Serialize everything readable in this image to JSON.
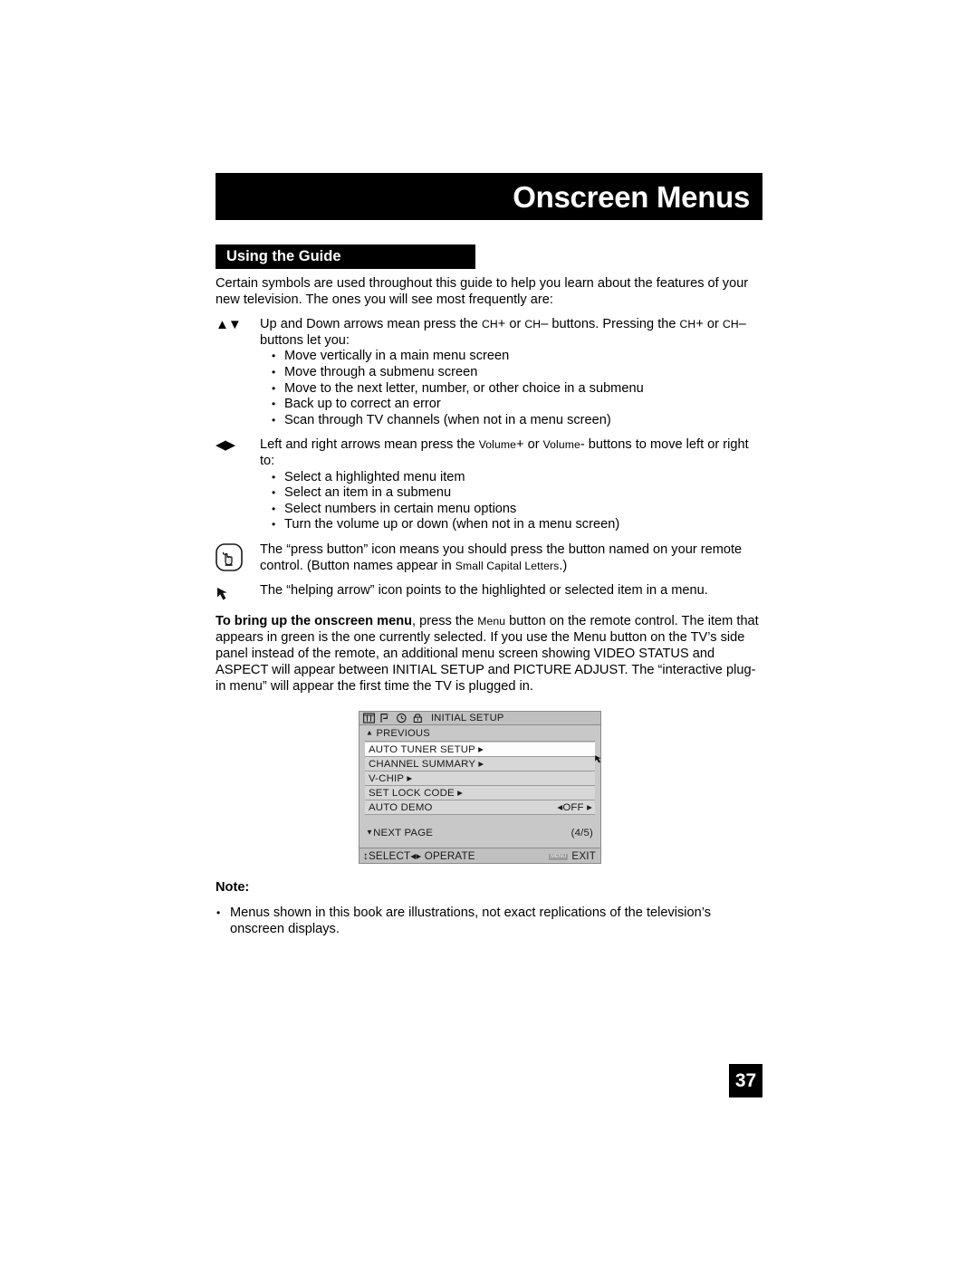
{
  "header": {
    "title": "Onscreen Menus",
    "section_title": "Using the Guide"
  },
  "intro": {
    "paragraph": "Certain symbols are used throughout this guide to help you learn about the features of your new television. The ones you will see most frequently are:"
  },
  "symbols": [
    {
      "icon": "up-down-arrows-icon",
      "glyph": "▲▼",
      "text_pre": "Up and Down arrows mean press the ",
      "sc1": "CH",
      "text_mid1": "+ or ",
      "sc2": "CH",
      "text_mid2": "– buttons. Pressing the ",
      "sc3": "CH",
      "text_mid3": "+ or ",
      "sc4": "CH",
      "text_post": "– buttons let you:",
      "bullets": [
        "Move vertically in a main menu screen",
        "Move through a submenu screen",
        "Move to the next letter, number, or other choice in a submenu",
        "Back up to correct an error",
        "Scan through TV channels (when not in a menu screen)"
      ]
    },
    {
      "icon": "left-right-arrows-icon",
      "glyph": "◀▶",
      "text_pre": "Left and right arrows mean press the ",
      "sc1": "Volume",
      "text_mid1": "+ or ",
      "sc2": "Volume",
      "text_post": "- buttons to move left or right to:",
      "bullets": [
        "Select a highlighted menu item",
        "Select an item in a submenu",
        "Select numbers in certain menu options",
        "Turn the volume up or down (when not in a menu screen)"
      ]
    },
    {
      "icon": "press-button-hand-icon",
      "text_pre": "The “press button” icon means you should press the button named on your remote control. (Button names appear in ",
      "sc1": "Small Capital Letters",
      "text_post": ".)"
    },
    {
      "icon": "helping-arrow-icon",
      "text_pre": "The “helping arrow” icon points to the highlighted or selected item in a menu."
    }
  ],
  "menu_intro": {
    "bold_lead": "To bring up the onscreen menu",
    "text_1": ", press the ",
    "sc_menu": "Menu",
    "text_2": " button on the remote control. The item that appears in green is the one currently selected. If you use the Menu button on the TV’s side panel instead of the remote, an additional menu screen showing VIDEO STATUS and ASPECT will appear between INITIAL SETUP and PICTURE ADJUST. The “interactive plug-in menu” will appear the first time the TV is plugged in."
  },
  "osd": {
    "title": "INITIAL SETUP",
    "title_icons": [
      "columns-icon",
      "flag-icon",
      "clock-icon",
      "lock-icon"
    ],
    "previous_label": "PREVIOUS",
    "previous_arrow": "▲",
    "rows": [
      {
        "label": "AUTO TUNER SETUP ▸",
        "value": "",
        "selected": true
      },
      {
        "label": "CHANNEL SUMMARY ▸",
        "value": "",
        "selected": false
      },
      {
        "label": "V-CHIP ▸",
        "value": "",
        "selected": false
      },
      {
        "label": "SET LOCK CODE ▸",
        "value": "",
        "selected": false
      },
      {
        "label": "AUTO DEMO",
        "value": "◂OFF ▸",
        "selected": false
      }
    ],
    "next_arrow": "▼",
    "next_label": "NEXT PAGE",
    "page_indicator": "(4/5)",
    "status_select": "↕SELECT◂▸ OPERATE",
    "status_menu_chip": "MENU",
    "status_exit": "EXIT",
    "helping_arrow_icon": "helping-arrow-icon"
  },
  "note": {
    "heading": "Note:",
    "items": [
      "Menus shown in this book are illustrations, not exact replications of the television’s onscreen displays."
    ]
  },
  "page_number": "37",
  "colors": {
    "header_bg": "#000000",
    "header_text": "#ffffff",
    "osd_bg": "#c8c8c8",
    "osd_row": "#d7d7d7",
    "osd_row_selected": "#fdfdfd",
    "osd_border": "#8a8a8a"
  }
}
